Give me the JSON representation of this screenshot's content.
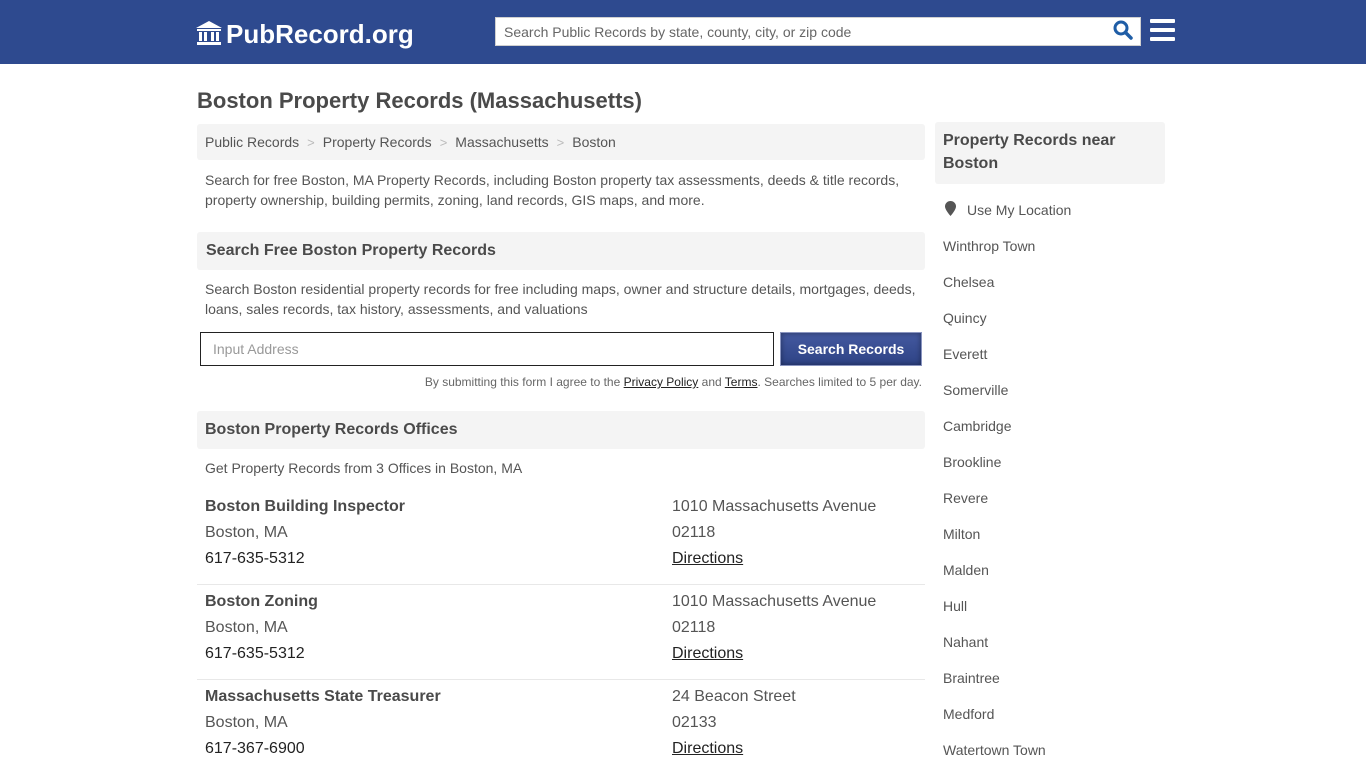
{
  "header": {
    "logo_text": "PubRecord.org",
    "search_placeholder": "Search Public Records by state, county, city, or zip code",
    "icons": {
      "logo": "courthouse-icon",
      "search": "search-icon",
      "menu": "hamburger-menu-icon"
    }
  },
  "page": {
    "title": "Boston Property Records (Massachusetts)",
    "breadcrumb": [
      "Public Records",
      "Property Records",
      "Massachusetts",
      "Boston"
    ],
    "breadcrumb_separator": ">",
    "intro": "Search for free Boston, MA Property Records, including Boston property tax assessments, deeds & title records, property ownership, building permits, zoning, land records, GIS maps, and more."
  },
  "search_section": {
    "heading": "Search Free Boston Property Records",
    "description": "Search Boston residential property records for free including maps, owner and structure details, mortgages, deeds, loans, sales records, tax history, assessments, and valuations",
    "input_placeholder": "Input Address",
    "input_value": "",
    "button_label": "Search Records",
    "disclaimer_prefix": "By submitting this form I agree to the ",
    "privacy_link": "Privacy Policy",
    "disclaimer_and": " and ",
    "terms_link": "Terms",
    "disclaimer_suffix": ". Searches limited to 5 per day."
  },
  "offices_section": {
    "heading": "Boston Property Records Offices",
    "description": "Get Property Records from 3 Offices in Boston, MA",
    "offices": [
      {
        "name": "Boston Building Inspector",
        "city": "Boston, MA",
        "phone": "617-635-5312",
        "street": "1010 Massachusetts Avenue",
        "zip": "02118",
        "directions_label": "Directions"
      },
      {
        "name": "Boston Zoning",
        "city": "Boston, MA",
        "phone": "617-635-5312",
        "street": "1010 Massachusetts Avenue",
        "zip": "02118",
        "directions_label": "Directions"
      },
      {
        "name": "Massachusetts State Treasurer",
        "city": "Boston, MA",
        "phone": "617-367-6900",
        "street": "24 Beacon Street",
        "zip": "02133",
        "directions_label": "Directions"
      }
    ]
  },
  "sidebar": {
    "heading": "Property Records near Boston",
    "use_location_label": "Use My Location",
    "use_location_icon": "map-marker-icon",
    "nearby": [
      "Winthrop Town",
      "Chelsea",
      "Quincy",
      "Everett",
      "Somerville",
      "Cambridge",
      "Brookline",
      "Revere",
      "Milton",
      "Malden",
      "Hull",
      "Nahant",
      "Braintree",
      "Medford",
      "Watertown Town"
    ]
  },
  "colors": {
    "brand_blue": "#2e4a8f",
    "search_icon_blue": "#1f5da6",
    "panel_gray": "#f4f4f4",
    "text_gray": "#555555",
    "heading_gray": "#4a4a4a"
  }
}
